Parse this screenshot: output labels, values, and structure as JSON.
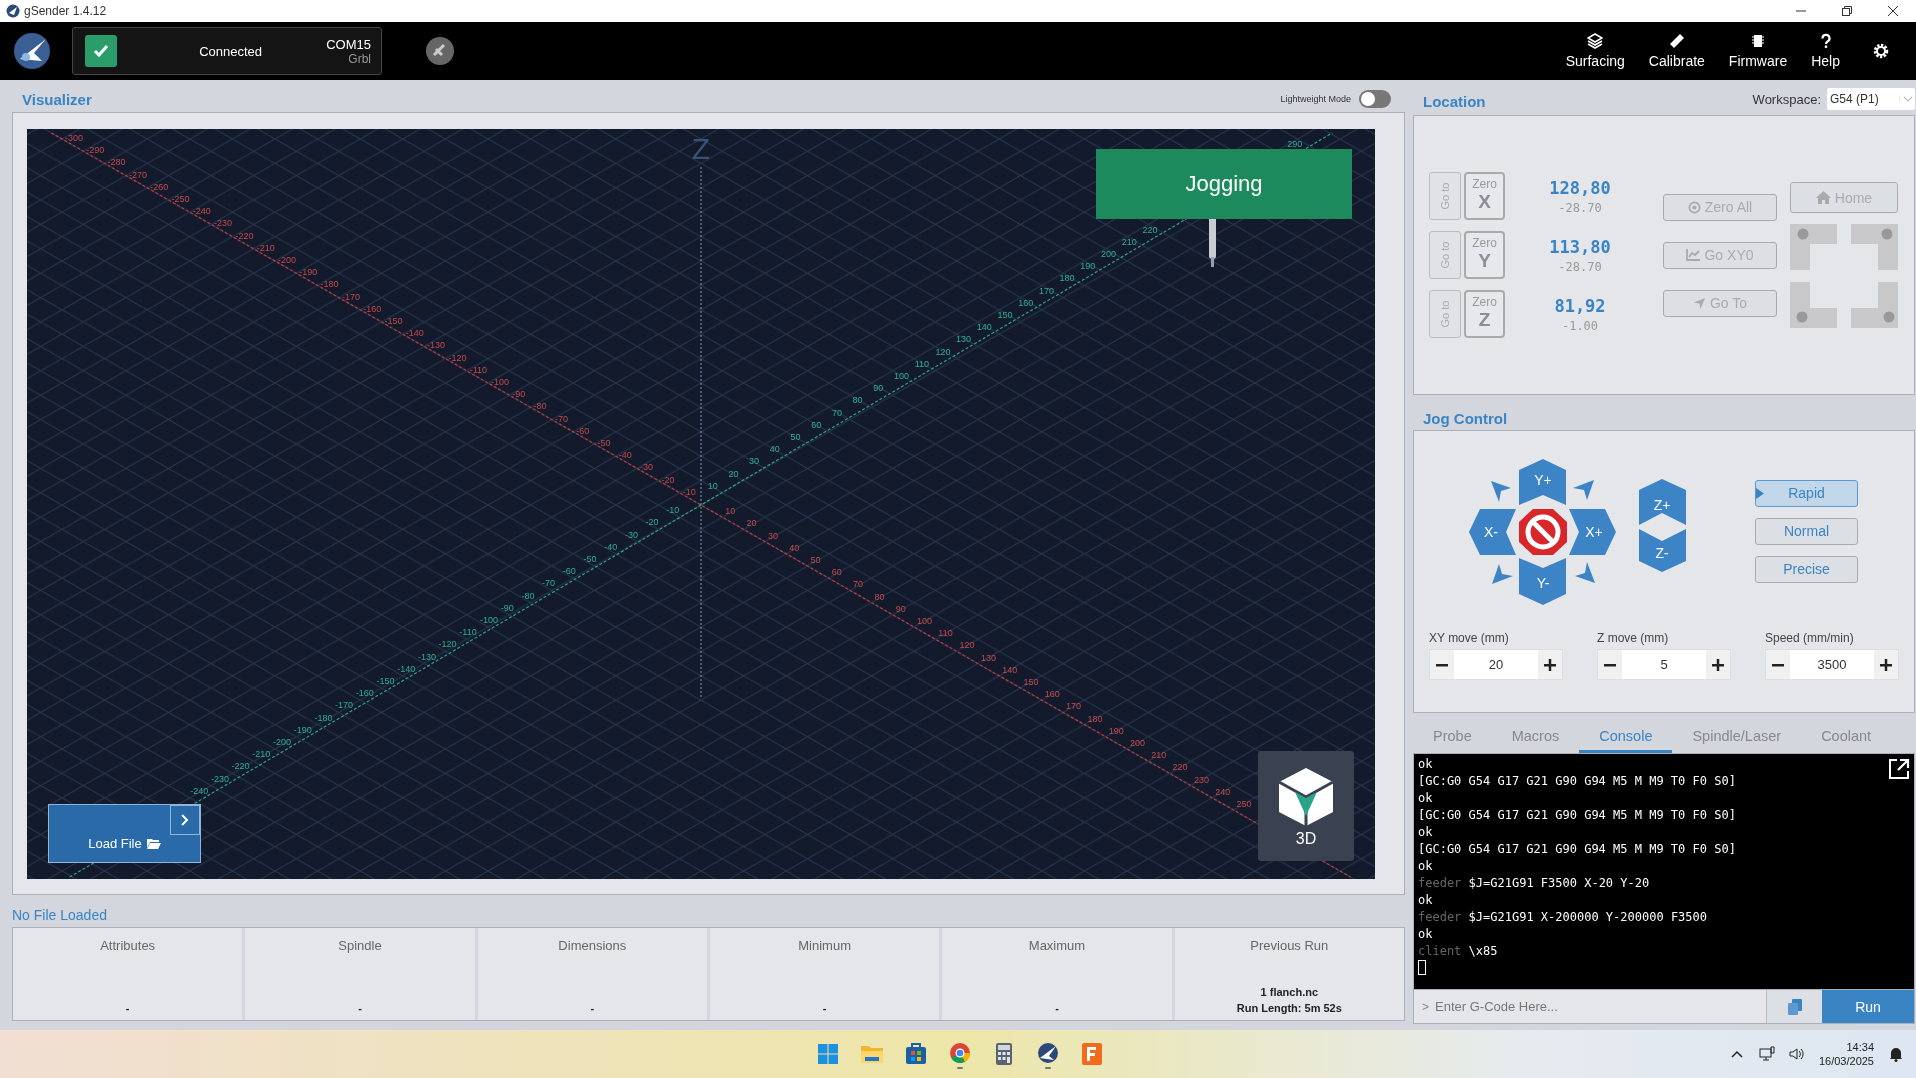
{
  "window": {
    "title": "gSender 1.4.12"
  },
  "header": {
    "connection": {
      "status": "Connected",
      "port": "COM15",
      "firmware": "Grbl",
      "connected": true
    },
    "nav": [
      {
        "kind": "surfacing",
        "label": "Surfacing"
      },
      {
        "kind": "calibrate",
        "label": "Calibrate"
      },
      {
        "kind": "firmware",
        "label": "Firmware"
      },
      {
        "kind": "help",
        "label": "Help"
      }
    ]
  },
  "visualizer": {
    "title": "Visualizer",
    "lightweight_mode": {
      "label": "Lightweight Mode",
      "on": false
    },
    "z_axis_label": "Z",
    "x_ticks_negative": [
      "-300",
      "-290",
      "-280",
      "-270",
      "-260",
      "-250",
      "-240",
      "-230",
      "-220",
      "-210",
      "-200",
      "-190",
      "-180",
      "-170",
      "-160",
      "-150",
      "-140",
      "-130",
      "-120",
      "-110",
      "-100",
      "-90",
      "-80",
      "-70",
      "-60",
      "-50",
      "-40",
      "-30",
      "-20",
      "-10"
    ],
    "x_ticks_positive": [
      "10",
      "20",
      "30",
      "40",
      "50",
      "60",
      "70",
      "80",
      "90",
      "100",
      "110",
      "120",
      "130",
      "140",
      "150",
      "160",
      "170",
      "180",
      "190",
      "200",
      "210",
      "220",
      "230",
      "240",
      "250"
    ],
    "y_ticks_negative": [
      "-240",
      "-230",
      "-220",
      "-210",
      "-200",
      "-190",
      "-180",
      "-170",
      "-160",
      "-150",
      "-140",
      "-130",
      "-120",
      "-110",
      "-100",
      "-90",
      "-80",
      "-70",
      "-60",
      "-50",
      "-40",
      "-30",
      "-20",
      "-10"
    ],
    "y_ticks_positive": [
      "10",
      "20",
      "30",
      "40",
      "50",
      "60",
      "70",
      "80",
      "90",
      "100",
      "110",
      "120",
      "130",
      "140",
      "150",
      "160",
      "170",
      "180",
      "190",
      "200",
      "210",
      "220"
    ],
    "y_ticks_positive_far": [
      "290"
    ],
    "status_banner": "Jogging",
    "load_file": "Load File",
    "view_label": "3D"
  },
  "location": {
    "title": "Location",
    "workspace_label": "Workspace:",
    "workspace": "G54 (P1)",
    "axes": [
      {
        "goto": "Go to",
        "zero": "Zero",
        "axis": "X",
        "value": "128,80",
        "machine": "-28.70"
      },
      {
        "goto": "Go to",
        "zero": "Zero",
        "axis": "Y",
        "value": "113,80",
        "machine": "-28.70"
      },
      {
        "goto": "Go to",
        "zero": "Zero",
        "axis": "Z",
        "value": "81,92",
        "machine": "-1.00"
      }
    ],
    "actions": [
      {
        "kind": "zero",
        "label": "Zero All"
      },
      {
        "kind": "xy0",
        "label": "Go XY0"
      },
      {
        "kind": "goto",
        "label": "Go To"
      }
    ],
    "home": "Home"
  },
  "jog": {
    "title": "Jog Control",
    "pad": {
      "y_plus": "Y+",
      "x_minus": "X-",
      "x_plus": "X+",
      "y_minus": "Y-",
      "z_plus": "Z+",
      "z_minus": "Z-"
    },
    "speeds": [
      {
        "label": "Rapid",
        "selected": true
      },
      {
        "label": "Normal",
        "selected": false
      },
      {
        "label": "Precise",
        "selected": false
      }
    ],
    "inputs": [
      {
        "label": "XY move (mm)",
        "value": "20"
      },
      {
        "label": "Z move (mm)",
        "value": "5"
      },
      {
        "label": "Speed (mm/min)",
        "value": "3500"
      }
    ]
  },
  "tabs": [
    {
      "label": "Probe",
      "selected": false
    },
    {
      "label": "Macros",
      "selected": false
    },
    {
      "label": "Console",
      "selected": true
    },
    {
      "label": "Spindle/Laser",
      "selected": false
    },
    {
      "label": "Coolant",
      "selected": false
    }
  ],
  "console": {
    "lines": [
      {
        "kind": "reply",
        "text": "ok"
      },
      {
        "kind": "reply",
        "text": "[GC:G0 G54 G17 G21 G90 G94 M5 M M9 T0 F0 S0]"
      },
      {
        "kind": "reply",
        "text": "ok"
      },
      {
        "kind": "reply",
        "text": "[GC:G0 G54 G17 G21 G90 G94 M5 M M9 T0 F0 S0]"
      },
      {
        "kind": "reply",
        "text": "ok"
      },
      {
        "kind": "reply",
        "text": "[GC:G0 G54 G17 G21 G90 G94 M5 M M9 T0 F0 S0]"
      },
      {
        "kind": "reply",
        "text": "ok"
      },
      {
        "kind": "sent",
        "source": "feeder",
        "text": "$J=G21G91 F3500 X-20 Y-20"
      },
      {
        "kind": "reply",
        "text": "ok"
      },
      {
        "kind": "sent",
        "source": "feeder",
        "text": "$J=G21G91 X-200000 Y-200000 F3500"
      },
      {
        "kind": "reply",
        "text": "ok"
      },
      {
        "kind": "sent",
        "source": "client",
        "text": "\\x85"
      }
    ],
    "prompt": ">",
    "input": {
      "placeholder": "Enter G-Code Here..."
    },
    "run": "Run"
  },
  "file": {
    "status": "No File Loaded",
    "columns": [
      {
        "heading": "Attributes",
        "lines": [
          "-"
        ]
      },
      {
        "heading": "Spindle",
        "lines": [
          "-"
        ]
      },
      {
        "heading": "Dimensions",
        "lines": [
          "-"
        ]
      },
      {
        "heading": "Minimum",
        "lines": [
          "-"
        ]
      },
      {
        "heading": "Maximum",
        "lines": [
          "-"
        ]
      },
      {
        "heading": "Previous Run",
        "lines": [
          "1 flanch.nc",
          "Run Length: 5m 52s"
        ]
      }
    ]
  },
  "taskbar": {
    "time": "14:34",
    "date": "16/03/2025"
  }
}
